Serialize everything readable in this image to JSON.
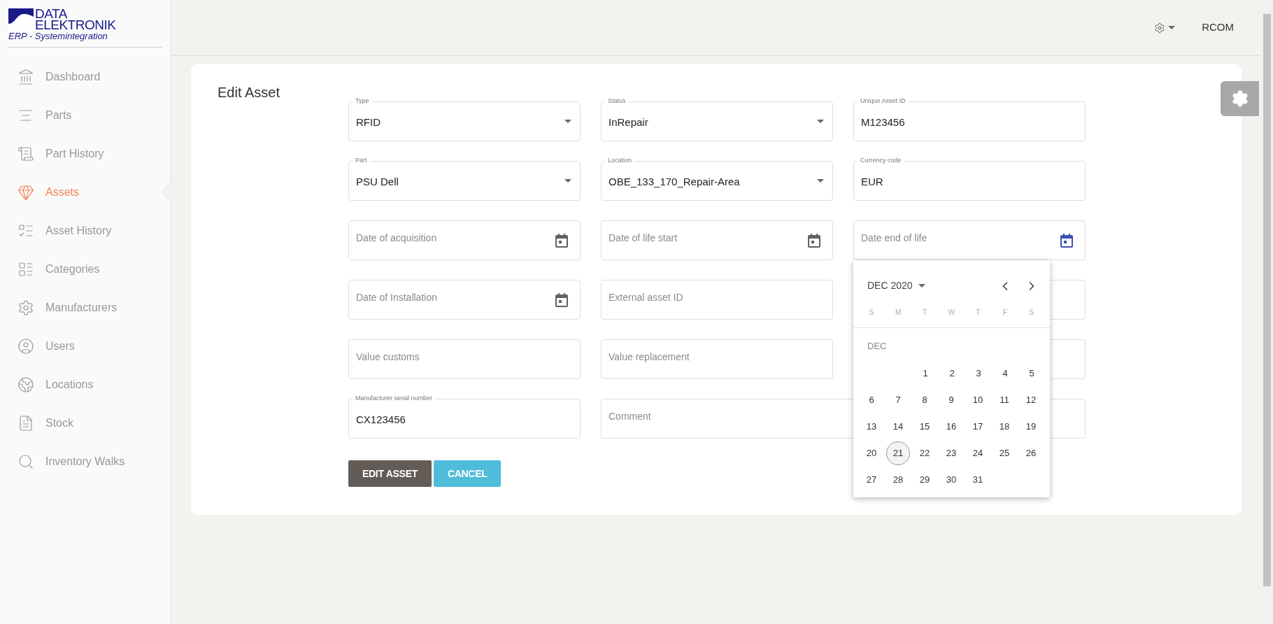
{
  "logo": {
    "line_1": "DATA",
    "line_2": "ELEKTRONIK",
    "tagline": "ERP - Systemintegration"
  },
  "sidebar": {
    "items": [
      {
        "label": "Dashboard",
        "selected": false
      },
      {
        "label": "Parts",
        "selected": false
      },
      {
        "label": "Part History",
        "selected": false
      },
      {
        "label": "Assets",
        "selected": true
      },
      {
        "label": "Asset History",
        "selected": false
      },
      {
        "label": "Categories",
        "selected": false
      },
      {
        "label": "Manufacturers",
        "selected": false
      },
      {
        "label": "Users",
        "selected": false
      },
      {
        "label": "Locations",
        "selected": false
      },
      {
        "label": "Stock",
        "selected": false
      },
      {
        "label": "Inventory Walks",
        "selected": false
      }
    ]
  },
  "topbar": {
    "user": "RCOM"
  },
  "form": {
    "title": "Edit Asset",
    "fields": [
      {
        "kind": "select",
        "label": "Type",
        "value": "RFID"
      },
      {
        "kind": "select",
        "label": "Status",
        "value": "InRepair"
      },
      {
        "kind": "text",
        "label": "Unique Asset ID",
        "value": "M123456"
      },
      {
        "kind": "select",
        "label": "Part",
        "value": "PSU Dell"
      },
      {
        "kind": "select",
        "label": "Location",
        "value": "OBE_133_170_Repair-Area"
      },
      {
        "kind": "text",
        "label": "Currency code",
        "value": "EUR"
      },
      {
        "kind": "date",
        "placeholder": "Date of acquisition",
        "focused": false
      },
      {
        "kind": "date",
        "placeholder": "Date of life start",
        "focused": false
      },
      {
        "kind": "date",
        "placeholder": "Date end of life",
        "focused": true
      },
      {
        "kind": "date",
        "placeholder": "Date of Installation",
        "focused": false
      },
      {
        "kind": "text",
        "placeholder": "External asset ID"
      },
      {
        "kind": "text"
      },
      {
        "kind": "text",
        "placeholder": "Value customs"
      },
      {
        "kind": "text",
        "placeholder": "Value replacement"
      },
      {
        "kind": "text"
      },
      {
        "kind": "text",
        "label": "Manufacturer serial number",
        "value": "CX123456"
      },
      {
        "kind": "wide",
        "placeholder": "Comment"
      }
    ],
    "buttons": [
      {
        "label": "EDIT ASSET",
        "kind": "primary"
      },
      {
        "label": "CANCEL",
        "kind": "secondary"
      }
    ]
  },
  "datepicker": {
    "month_label": "DEC 2020",
    "weekdays": [
      "S",
      "M",
      "T",
      "W",
      "T",
      "F",
      "S"
    ],
    "month_short": "DEC",
    "weeks": [
      {
        "starts_midweek": true,
        "days": [
          {
            "label": "1",
            "selected": false
          },
          {
            "label": "2",
            "selected": false
          },
          {
            "label": "3",
            "selected": false
          },
          {
            "label": "4",
            "selected": false
          },
          {
            "label": "5",
            "selected": false
          }
        ]
      },
      {
        "starts_midweek": false,
        "days": [
          {
            "label": "6",
            "selected": false
          },
          {
            "label": "7",
            "selected": false
          },
          {
            "label": "8",
            "selected": false
          },
          {
            "label": "9",
            "selected": false
          },
          {
            "label": "10",
            "selected": false
          },
          {
            "label": "11",
            "selected": false
          },
          {
            "label": "12",
            "selected": false
          }
        ]
      },
      {
        "starts_midweek": false,
        "days": [
          {
            "label": "13",
            "selected": false
          },
          {
            "label": "14",
            "selected": false
          },
          {
            "label": "15",
            "selected": false
          },
          {
            "label": "16",
            "selected": false
          },
          {
            "label": "17",
            "selected": false
          },
          {
            "label": "18",
            "selected": false
          },
          {
            "label": "19",
            "selected": false
          }
        ]
      },
      {
        "starts_midweek": false,
        "days": [
          {
            "label": "20",
            "selected": false
          },
          {
            "label": "21",
            "selected": true
          },
          {
            "label": "22",
            "selected": false
          },
          {
            "label": "23",
            "selected": false
          },
          {
            "label": "24",
            "selected": false
          },
          {
            "label": "25",
            "selected": false
          },
          {
            "label": "26",
            "selected": false
          }
        ]
      },
      {
        "starts_midweek": false,
        "days": [
          {
            "label": "27",
            "selected": false
          },
          {
            "label": "28",
            "selected": false
          },
          {
            "label": "29",
            "selected": false
          },
          {
            "label": "30",
            "selected": false
          },
          {
            "label": "31",
            "selected": false
          }
        ]
      }
    ]
  }
}
